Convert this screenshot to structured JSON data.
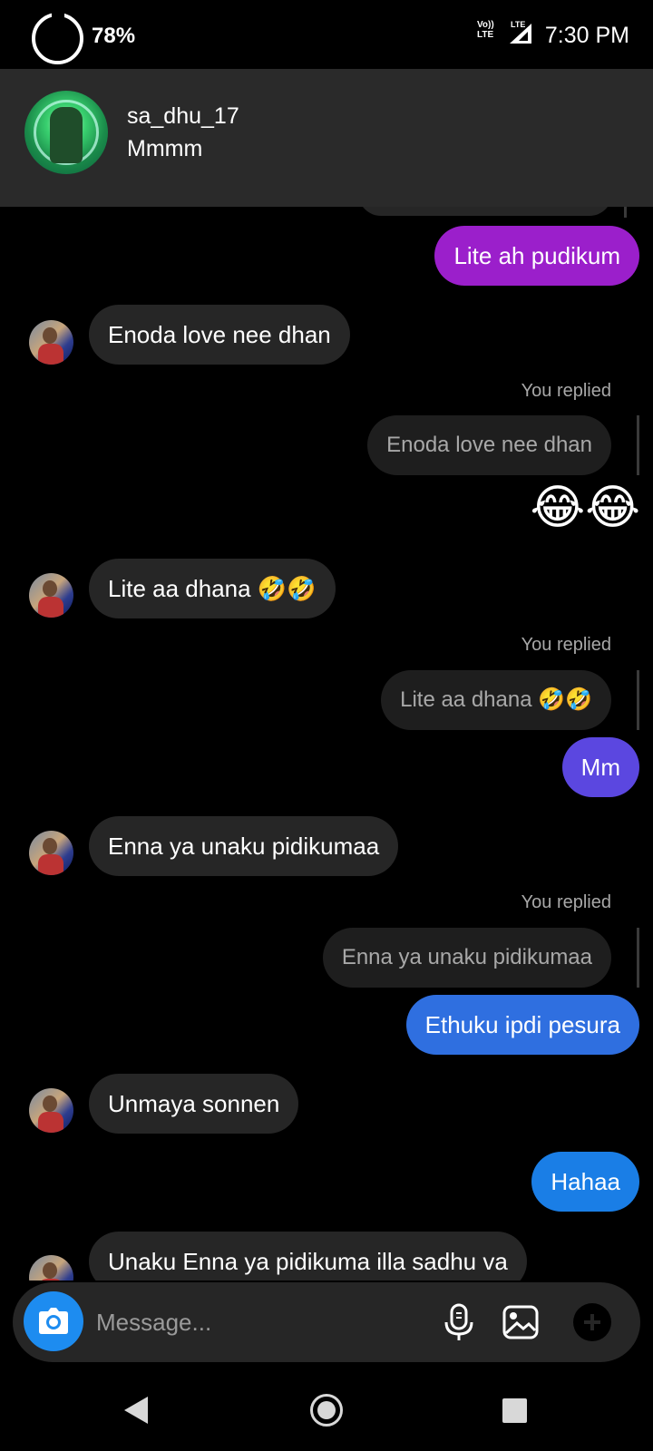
{
  "status_bar": {
    "battery_percent": "78%",
    "network_top": "Vo))",
    "network_bottom": "LTE",
    "signal_label": "LTE",
    "time": "7:30 PM"
  },
  "notification": {
    "sender": "sa_dhu_17",
    "preview": "Mmmm"
  },
  "messages": [
    {
      "from": "me",
      "text": "Lite ah pudikum",
      "color": "#9b1fcb"
    },
    {
      "from": "them",
      "text": "Enoda love nee dhan"
    },
    {
      "from": "me",
      "type": "reply",
      "reply_label": "You replied",
      "quoted": "Enoda love nee dhan"
    },
    {
      "from": "me",
      "type": "emoji",
      "text": "😂😂"
    },
    {
      "from": "them",
      "text": "Lite aa dhana 🤣🤣"
    },
    {
      "from": "me",
      "type": "reply",
      "reply_label": "You replied",
      "quoted": "Lite aa dhana 🤣🤣"
    },
    {
      "from": "me",
      "text": "Mm",
      "color": "#5b47e0"
    },
    {
      "from": "them",
      "text": "Enna ya unaku pidikumaa"
    },
    {
      "from": "me",
      "type": "reply",
      "reply_label": "You replied",
      "quoted": "Enna ya unaku pidikumaa"
    },
    {
      "from": "me",
      "text": "Ethuku ipdi pesura",
      "color": "#2f6fe0"
    },
    {
      "from": "them",
      "text": "Unmaya sonnen"
    },
    {
      "from": "me",
      "text": "Hahaa",
      "color": "#1a7ee6"
    },
    {
      "from": "them",
      "text": "Unaku Enna ya pidikuma illa sadhu va"
    }
  ],
  "composer": {
    "placeholder": "Message..."
  },
  "colors": {
    "accent_camera": "#1d8cf0",
    "background": "#000000"
  }
}
